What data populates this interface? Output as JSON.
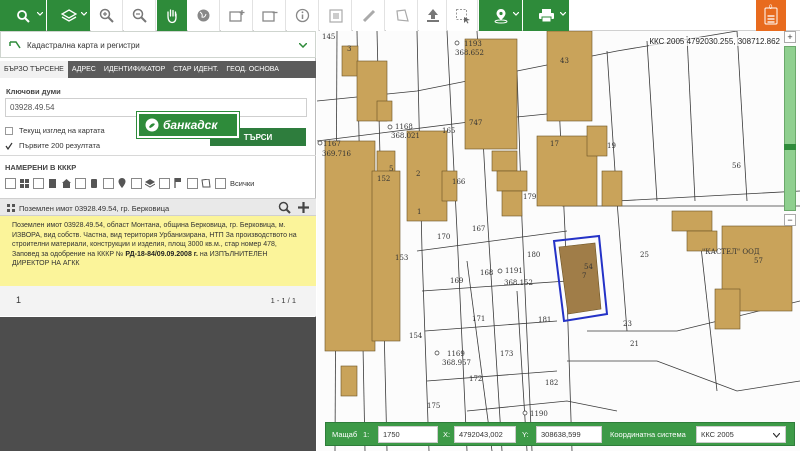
{
  "toolbar": {
    "tools": [
      "search",
      "layers",
      "zoom-in",
      "zoom-out",
      "pan",
      "globe",
      "add-object",
      "remove-object",
      "info",
      "measure-area",
      "measure-line",
      "polygon",
      "upload",
      "select",
      "location",
      "print",
      "menu"
    ],
    "menu_badge": "0"
  },
  "panel": {
    "layer_select": "Кадастрална карта и регистри",
    "tabs": [
      "БЪРЗО ТЪРСЕНЕ",
      "АДРЕС",
      "ИДЕНТИФИКАТОР",
      "СТАР ИДЕНТ.",
      "ГЕОД. ОСНОВА"
    ],
    "active_tab": 0,
    "keywords_label": "Ключови думи",
    "keywords_value": "03928.49.54",
    "option_current_view": "Текущ изглед на картата",
    "option_first_200": "Първите 200 резултата",
    "search_button": "ТЪРСИ",
    "found_label": "НАМЕРЕНИ В КККР",
    "all_label": "Всички",
    "result_title": "Поземлен имот 03928.49.54, гр. Берковица",
    "result_text_1": "Поземлен имот 03928.49.54, област Монтана, община Берковица, гр. Берковица, м. ИЗВОРА, вид собств. Частна, вид територия Урбанизирана, НТП За производството на строителни материали, конструкции и изделия, площ 3000 кв.м., стар номер 478,",
    "result_text_2": "Заповед за одобрение на КККР №",
    "result_text_bold": "РД-18-84/09.09.2008 г.",
    "result_text_3": "на ИЗПЪЛНИТЕЛЕН ДИРЕКТОР НА АГКК",
    "page_number": "1",
    "page_count": "1 - 1 / 1"
  },
  "ad": {
    "name": "банкадск"
  },
  "map": {
    "coordinate_readout": "ККС 2005 4792030.255, 308712.862",
    "labels": [
      "145",
      "1193",
      "368.652",
      "165",
      "747",
      "1168",
      "368.021",
      "1167",
      "369.716",
      "152",
      "166",
      "179",
      "56",
      "170",
      "167",
      "180",
      "153",
      "169",
      "168",
      "1191",
      "368.152",
      "25",
      "\"КАСТЕЛ\" ООД",
      "57",
      "171",
      "181",
      "23",
      "154",
      "21",
      "1169",
      "368.957",
      "173",
      "172",
      "182",
      "175",
      "1190",
      "17",
      "43",
      "54",
      "2",
      "1",
      "7",
      "3",
      "5",
      "19"
    ]
  },
  "statusbar": {
    "scale_label": "Мащаб",
    "scale_prefix": "1:",
    "scale_value": "1750",
    "x_label": "X:",
    "x_value": "4792043,002",
    "y_label": "Y:",
    "y_value": "308638,599",
    "crs_label": "Координатна система",
    "crs_value": "ККС 2005"
  },
  "colors": {
    "brand_green": "#2e8b3a",
    "building_fill": "#c9a35a",
    "highlight_parcel": "#2432c7",
    "result_bg": "#fbf49a",
    "menu_orange": "#e86b1e"
  }
}
